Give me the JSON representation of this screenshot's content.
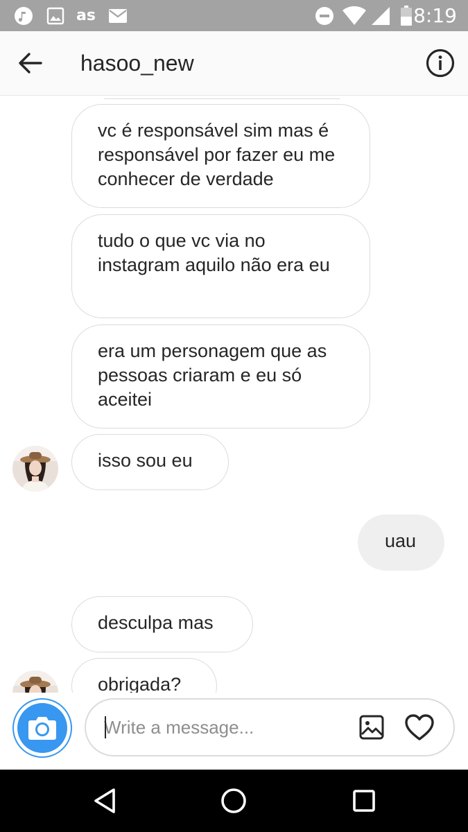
{
  "status_bar": {
    "time": "8:19",
    "left_icons": [
      "music-icon",
      "image-icon",
      "lastfm-icon",
      "mail-icon"
    ],
    "right_icons": [
      "do-not-disturb-icon",
      "wifi-icon",
      "signal-icon",
      "battery-icon"
    ],
    "lastfm_text": "as"
  },
  "header": {
    "title": "hasoo_new",
    "back_icon": "arrow-left-icon",
    "info_icon": "info-icon"
  },
  "thread": {
    "messages": [
      {
        "direction": "incoming",
        "text": "vc é responsável sim mas é responsável por fazer eu me conhecer de verdade"
      },
      {
        "direction": "incoming",
        "text": "tudo o que vc via no instagram aquilo não era eu"
      },
      {
        "direction": "incoming",
        "text": "era um personagem que as pessoas criaram e eu só aceitei"
      },
      {
        "direction": "incoming",
        "text": "isso sou eu"
      },
      {
        "direction": "outgoing",
        "text": "uau"
      },
      {
        "direction": "incoming",
        "text": "desculpa mas"
      },
      {
        "direction": "incoming",
        "text": "obrigada?"
      }
    ]
  },
  "composer": {
    "placeholder": "Write a message...",
    "value": "",
    "camera_icon": "camera-icon",
    "gallery_icon": "gallery-icon",
    "like_icon": "heart-icon"
  },
  "colors": {
    "accent": "#3897f0",
    "status_bar": "#a3a3a3",
    "outgoing_bubble": "#efefef",
    "bubble_border": "#dbdbdb"
  }
}
